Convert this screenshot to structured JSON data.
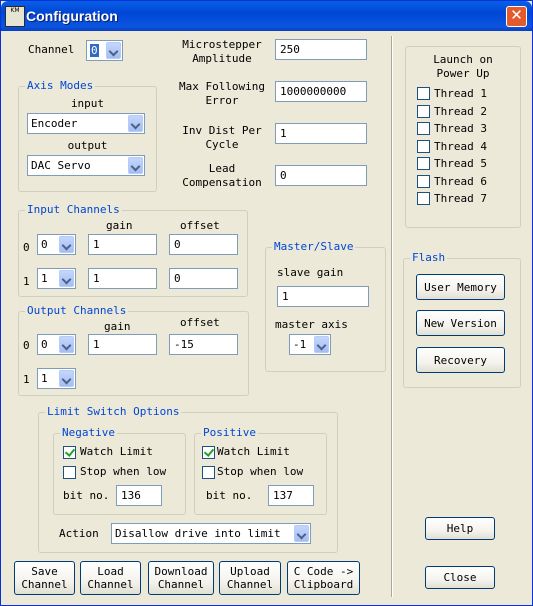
{
  "window": {
    "title": "Configuration",
    "icon_text": "KM"
  },
  "channel": {
    "label": "Channel",
    "value": "0"
  },
  "axis_modes": {
    "title": "Axis Modes",
    "input_label": "input",
    "input_value": "Encoder",
    "output_label": "output",
    "output_value": "DAC Servo"
  },
  "params": {
    "microstepper_label": "Microstepper\nAmplitude",
    "microstepper_value": "250",
    "max_follow_label": "Max Following\nError",
    "max_follow_value": "1000000000",
    "inv_dist_label": "Inv Dist Per\nCycle",
    "inv_dist_value": "1",
    "lead_comp_label": "Lead\nCompensation",
    "lead_comp_value": "0"
  },
  "input_channels": {
    "title": "Input Channels",
    "gain_label": "gain",
    "offset_label": "offset",
    "rows": [
      {
        "index": "0",
        "channel": "0",
        "gain": "1",
        "offset": "0"
      },
      {
        "index": "1",
        "channel": "1",
        "gain": "1",
        "offset": "0"
      }
    ]
  },
  "output_channels": {
    "title": "Output Channels",
    "gain_label": "gain",
    "offset_label": "offset",
    "rows": [
      {
        "index": "0",
        "channel": "0",
        "gain": "1",
        "offset": "-15"
      },
      {
        "index": "1",
        "channel": "1"
      }
    ]
  },
  "master_slave": {
    "title": "Master/Slave",
    "slave_gain_label": "slave gain",
    "slave_gain_value": "1",
    "master_axis_label": "master axis",
    "master_axis_value": "-1"
  },
  "limit_switch": {
    "title": "Limit Switch Options",
    "negative": {
      "title": "Negative",
      "watch_label": "Watch Limit",
      "watch_checked": true,
      "stop_label": "Stop when low",
      "stop_checked": false,
      "bit_label": "bit no.",
      "bit_value": "136"
    },
    "positive": {
      "title": "Positive",
      "watch_label": "Watch Limit",
      "watch_checked": true,
      "stop_label": "Stop when low",
      "stop_checked": false,
      "bit_label": "bit no.",
      "bit_value": "137"
    },
    "action_label": "Action",
    "action_value": "Disallow drive into limit"
  },
  "launch": {
    "title": "Launch on\nPower Up",
    "threads": [
      "Thread 1",
      "Thread 2",
      "Thread 3",
      "Thread 4",
      "Thread 5",
      "Thread 6",
      "Thread 7"
    ]
  },
  "flash": {
    "title": "Flash",
    "user_memory": "User Memory",
    "new_version": "New Version",
    "recovery": "Recovery"
  },
  "buttons": {
    "help": "Help",
    "close": "Close",
    "save_channel": "Save\nChannel",
    "load_channel": "Load\nChannel",
    "download_channel": "Download\nChannel",
    "upload_channel": "Upload\nChannel",
    "c_code": "C Code ->\nClipboard"
  }
}
